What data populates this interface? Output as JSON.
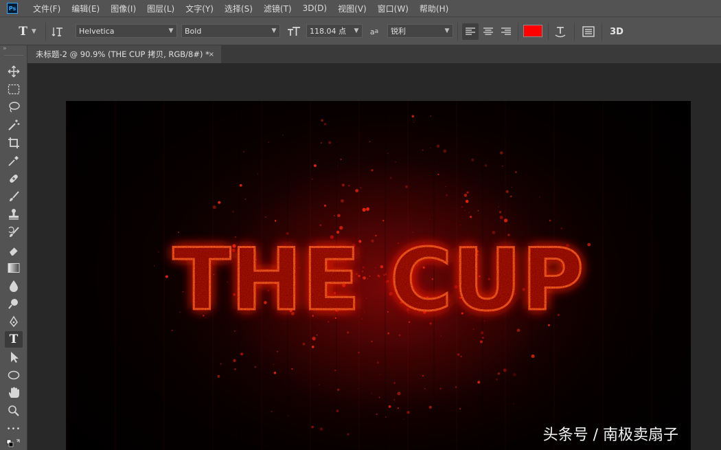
{
  "app": {
    "logo": "Ps"
  },
  "menu": [
    "文件(F)",
    "编辑(E)",
    "图像(I)",
    "图层(L)",
    "文字(Y)",
    "选择(S)",
    "滤镜(T)",
    "3D(D)",
    "视图(V)",
    "窗口(W)",
    "帮助(H)"
  ],
  "options": {
    "tool_icon": "T",
    "font_family": "Helvetica",
    "font_style": "Bold",
    "font_size": "118.04 点",
    "antialias_label": "a",
    "antialias_value": "锐利",
    "text_color": "#ff0000",
    "three_d_label": "3D"
  },
  "document": {
    "tab_title": "未标题-2 @ 90.9% (THE CUP 拷贝, RGB/8#) *",
    "tab_close": "×",
    "canvas_text": "THE CUP",
    "text_color": "#ff2a10"
  },
  "toolbox": {
    "grip": "»",
    "tools": [
      "move-tool-icon",
      "marquee-tool-icon",
      "lasso-tool-icon",
      "magic-wand-icon",
      "crop-tool-icon",
      "eyedropper-icon",
      "healing-brush-icon",
      "brush-tool-icon",
      "clone-stamp-icon",
      "history-brush-icon",
      "eraser-tool-icon",
      "gradient-tool-icon",
      "blur-tool-icon",
      "dodge-tool-icon",
      "pen-tool-icon",
      "type-tool-icon",
      "path-selection-icon",
      "ellipse-tool-icon",
      "hand-tool-icon",
      "zoom-tool-icon",
      "more-tools-icon"
    ],
    "active": "type-tool-icon",
    "type_glyph": "T",
    "more_glyph": "•••"
  },
  "watermark": "头条号 / 南极卖扇子"
}
